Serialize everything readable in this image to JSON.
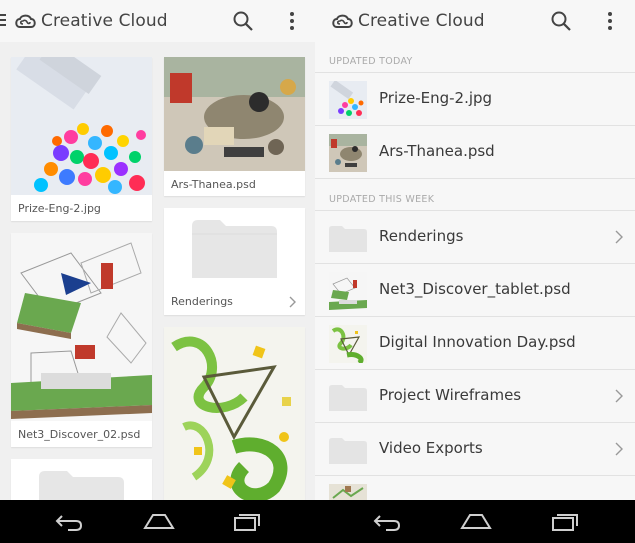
{
  "app_title": "Creative Cloud",
  "left_grid": {
    "items": [
      {
        "label": "Prize-Eng-2.jpg"
      },
      {
        "label": "Ars-Thanea.psd"
      },
      {
        "label": "Renderings"
      },
      {
        "label": "Net3_Discover_02.psd"
      }
    ]
  },
  "right_list": {
    "sections": [
      {
        "title": "UPDATED TODAY"
      },
      {
        "title": "UPDATED THIS WEEK"
      }
    ],
    "items": [
      {
        "name": "Prize-Eng-2.jpg",
        "icon": "image-thumbnail"
      },
      {
        "name": "Ars-Thanea.psd",
        "icon": "image-thumbnail"
      },
      {
        "name": "Renderings",
        "icon": "folder-icon"
      },
      {
        "name": "Net3_Discover_tablet.psd",
        "icon": "image-thumbnail"
      },
      {
        "name": "Digital Innovation Day.psd",
        "icon": "image-thumbnail"
      },
      {
        "name": "Project Wireframes",
        "icon": "folder-icon"
      },
      {
        "name": "Video Exports",
        "icon": "folder-icon"
      }
    ]
  },
  "colors": {
    "background": "#f0f0f0",
    "text": "#3a3a3a",
    "folder": "#e4e4e4"
  }
}
